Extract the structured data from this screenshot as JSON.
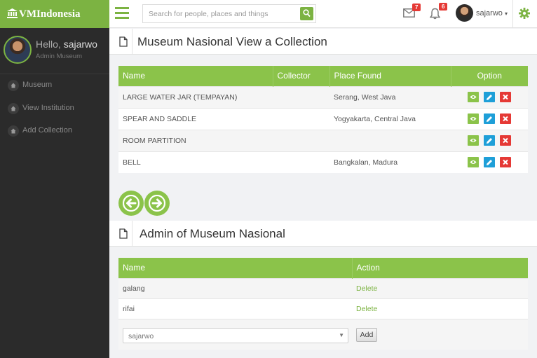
{
  "brand": {
    "name": "VMIndonesia"
  },
  "search": {
    "placeholder": "Search for people, places and things"
  },
  "notifications": {
    "messages_count": "7",
    "alerts_count": "6"
  },
  "user": {
    "name": "sajarwo"
  },
  "sidebar": {
    "greeting": "Hello,",
    "username": "sajarwo",
    "role": "Admin Museum",
    "items": [
      {
        "label": "Museum"
      },
      {
        "label": "View Institution"
      },
      {
        "label": "Add Collection"
      }
    ]
  },
  "collection": {
    "title": "Museum Nasional View a Collection",
    "columns": [
      "Name",
      "Collector",
      "Place Found",
      "Option"
    ],
    "rows": [
      {
        "name": "LARGE WATER JAR (TEMPAYAN)",
        "collector": "",
        "place": "Serang, West Java"
      },
      {
        "name": "SPEAR AND SADDLE",
        "collector": "",
        "place": "Yogyakarta, Central Java"
      },
      {
        "name": "ROOM PARTITION",
        "collector": "",
        "place": ""
      },
      {
        "name": "BELL",
        "collector": "",
        "place": "Bangkalan, Madura"
      }
    ]
  },
  "admins": {
    "title": "Admin of Museum Nasional",
    "columns": [
      "Name",
      "Action"
    ],
    "rows": [
      {
        "name": "galang",
        "action": "Delete"
      },
      {
        "name": "rifai",
        "action": "Delete"
      }
    ],
    "select_value": "sajarwo",
    "add_label": "Add"
  },
  "colors": {
    "accent": "#7cb342",
    "header_green": "#8bc34a",
    "sidebar": "#2b2b2b",
    "edit": "#1e9fd8",
    "delete": "#e53935"
  }
}
